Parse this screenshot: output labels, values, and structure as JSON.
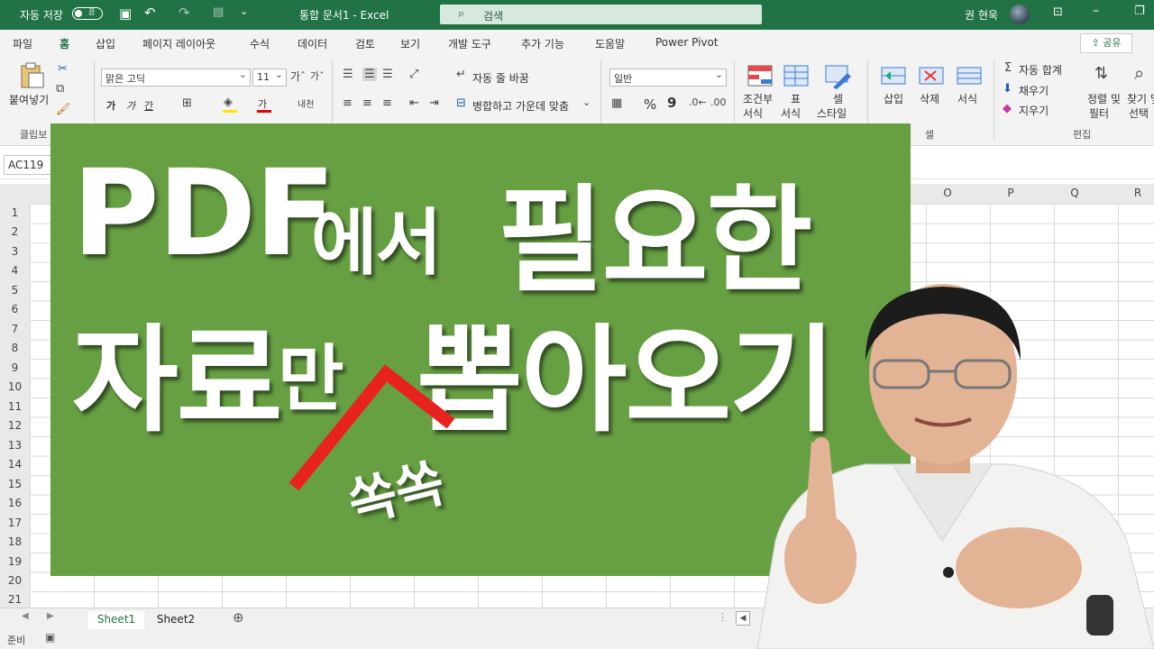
{
  "titlebar": {
    "autosave_label": "자동 저장",
    "autosave_state": "끔",
    "document_title": "통합 문서1  -  Excel",
    "search_placeholder": "검색",
    "user_name": "권 현욱"
  },
  "menu": {
    "tabs": [
      "파일",
      "홈",
      "삽입",
      "페이지 레이아웃",
      "수식",
      "데이터",
      "검토",
      "보기",
      "개발 도구",
      "추가 기능",
      "도움말",
      "Power Pivot"
    ],
    "active_tab": "홈",
    "share_label": "공유"
  },
  "ribbon": {
    "clipboard": {
      "paste_label": "붙여넣기",
      "group_label": "클립보"
    },
    "font": {
      "font_name": "맑은 고딕",
      "font_size": "11",
      "bold": "가",
      "italic": "가",
      "underline": "간",
      "font_color_glyph": "가"
    },
    "alignment": {
      "wrap_text": "자동 줄 바꿈",
      "merge_center": "병합하고 가운데 맞춤"
    },
    "number": {
      "format": "일반",
      "percent": "%",
      "comma": "9"
    },
    "styles": {
      "conditional": [
        "조건부",
        "서식"
      ],
      "table": [
        "표",
        "서식"
      ],
      "cell_style": [
        "셀",
        "스타일"
      ]
    },
    "cells": {
      "insert": "삽입",
      "delete": "삭제",
      "format": "서식",
      "group_label": "셀"
    },
    "editing": {
      "autosum": "자동 합계",
      "fill": "채우기",
      "clear": "지우기",
      "sort_filter": [
        "정렬 및",
        "필터"
      ],
      "find_select": [
        "찾기 및",
        "선택"
      ],
      "group_label": "편집"
    }
  },
  "formula_bar": {
    "name_box": "AC119"
  },
  "sheet": {
    "columns_visible": [
      "O",
      "P",
      "Q",
      "R"
    ],
    "rows": [
      "1",
      "2",
      "3",
      "4",
      "5",
      "6",
      "7",
      "8",
      "9",
      "10",
      "11",
      "12",
      "13",
      "14",
      "15",
      "16",
      "17",
      "18",
      "19",
      "20",
      "21"
    ]
  },
  "sheet_tabs": [
    "Sheet1",
    "Sheet2"
  ],
  "status": {
    "ready": "준비"
  },
  "overlay": {
    "line1_big": "PDF",
    "line1_small": "에서",
    "line1_big2": "필요한",
    "line2_big": "자료",
    "line2_small": "만",
    "line2_big2": "뽑아오기",
    "handwritten": "쏙쏙",
    "panel_color": "#67a043",
    "caret_color": "#e8231f"
  },
  "colors": {
    "excel_green": "#217346",
    "ribbon_bg": "#f3f3f3"
  }
}
